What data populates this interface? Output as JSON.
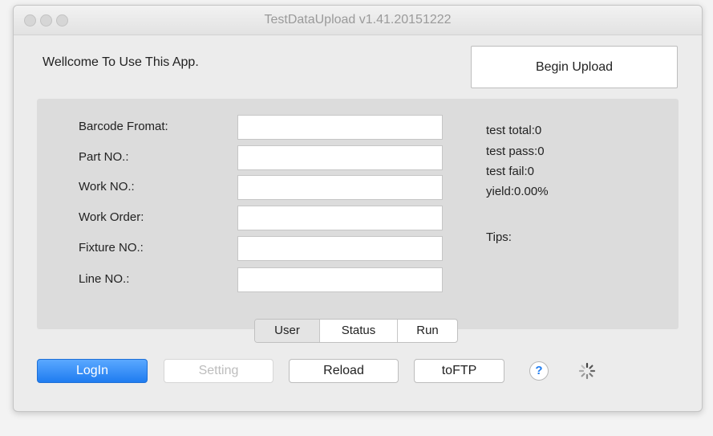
{
  "window": {
    "title": "TestDataUpload v1.41.20151222"
  },
  "header": {
    "welcome_text": "Wellcome To Use This App.",
    "upload_button": "Begin Upload"
  },
  "form": {
    "fields": [
      {
        "label": "Barcode Fromat:",
        "value": ""
      },
      {
        "label": "Part NO.:",
        "value": ""
      },
      {
        "label": "Work NO.:",
        "value": ""
      },
      {
        "label": "Work Order:",
        "value": ""
      },
      {
        "label": "Fixture NO.:",
        "value": ""
      },
      {
        "label": "Line NO.:",
        "value": ""
      }
    ]
  },
  "stats": {
    "test_total": "test total:0",
    "test_pass": "test pass:0",
    "test_fail": "test fail:0",
    "yield": "yield:0.00%",
    "tips": "Tips:"
  },
  "tabs": {
    "items": [
      "User",
      "Status",
      "Run"
    ],
    "selected": "User"
  },
  "toolbar": {
    "login": "LogIn",
    "setting": "Setting",
    "reload": "Reload",
    "toftp": "toFTP",
    "help": "?"
  },
  "colors": {
    "accent": "#1f7cf0",
    "panel": "#dcdcdc",
    "window": "#ececec"
  }
}
